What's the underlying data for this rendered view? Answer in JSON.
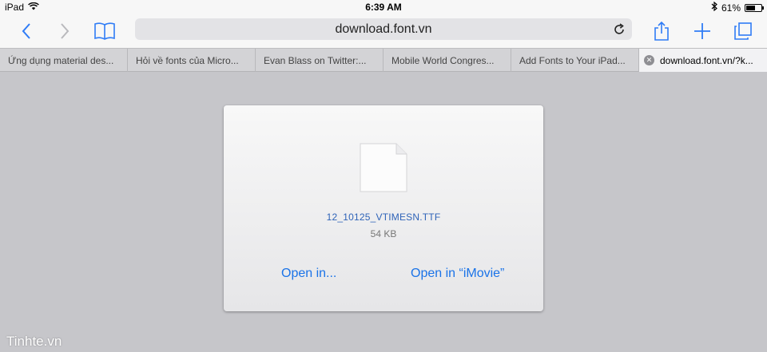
{
  "status_bar": {
    "device": "iPad",
    "time": "6:39 AM",
    "battery_text": "61%",
    "battery_level": 0.61,
    "wifi_icon": "wifi-icon",
    "bluetooth_icon": "bluetooth-icon"
  },
  "toolbar": {
    "back_icon": "back-chevron-icon",
    "forward_icon": "forward-chevron-icon",
    "bookmarks_icon": "book-icon",
    "url": "download.font.vn",
    "reload_icon": "reload-icon",
    "share_icon": "share-icon",
    "new_tab_icon": "plus-icon",
    "tabs_icon": "tabs-icon",
    "accent_color": "#2f7cf6"
  },
  "tabs": [
    {
      "label": "Ứng dụng material des..."
    },
    {
      "label": "Hỏi về fonts của Micro..."
    },
    {
      "label": "Evan Blass on Twitter:..."
    },
    {
      "label": "Mobile World Congres..."
    },
    {
      "label": "Add Fonts to Your iPad..."
    },
    {
      "label": "download.font.vn/?k...",
      "active": true
    }
  ],
  "download": {
    "filename": "12_10125_VTIMESN.TTF",
    "size": "54 KB",
    "open_in_label": "Open in...",
    "open_in_app_label": "Open in “iMovie”",
    "file_icon": "document-icon"
  },
  "watermark": "Tinhte.vn"
}
